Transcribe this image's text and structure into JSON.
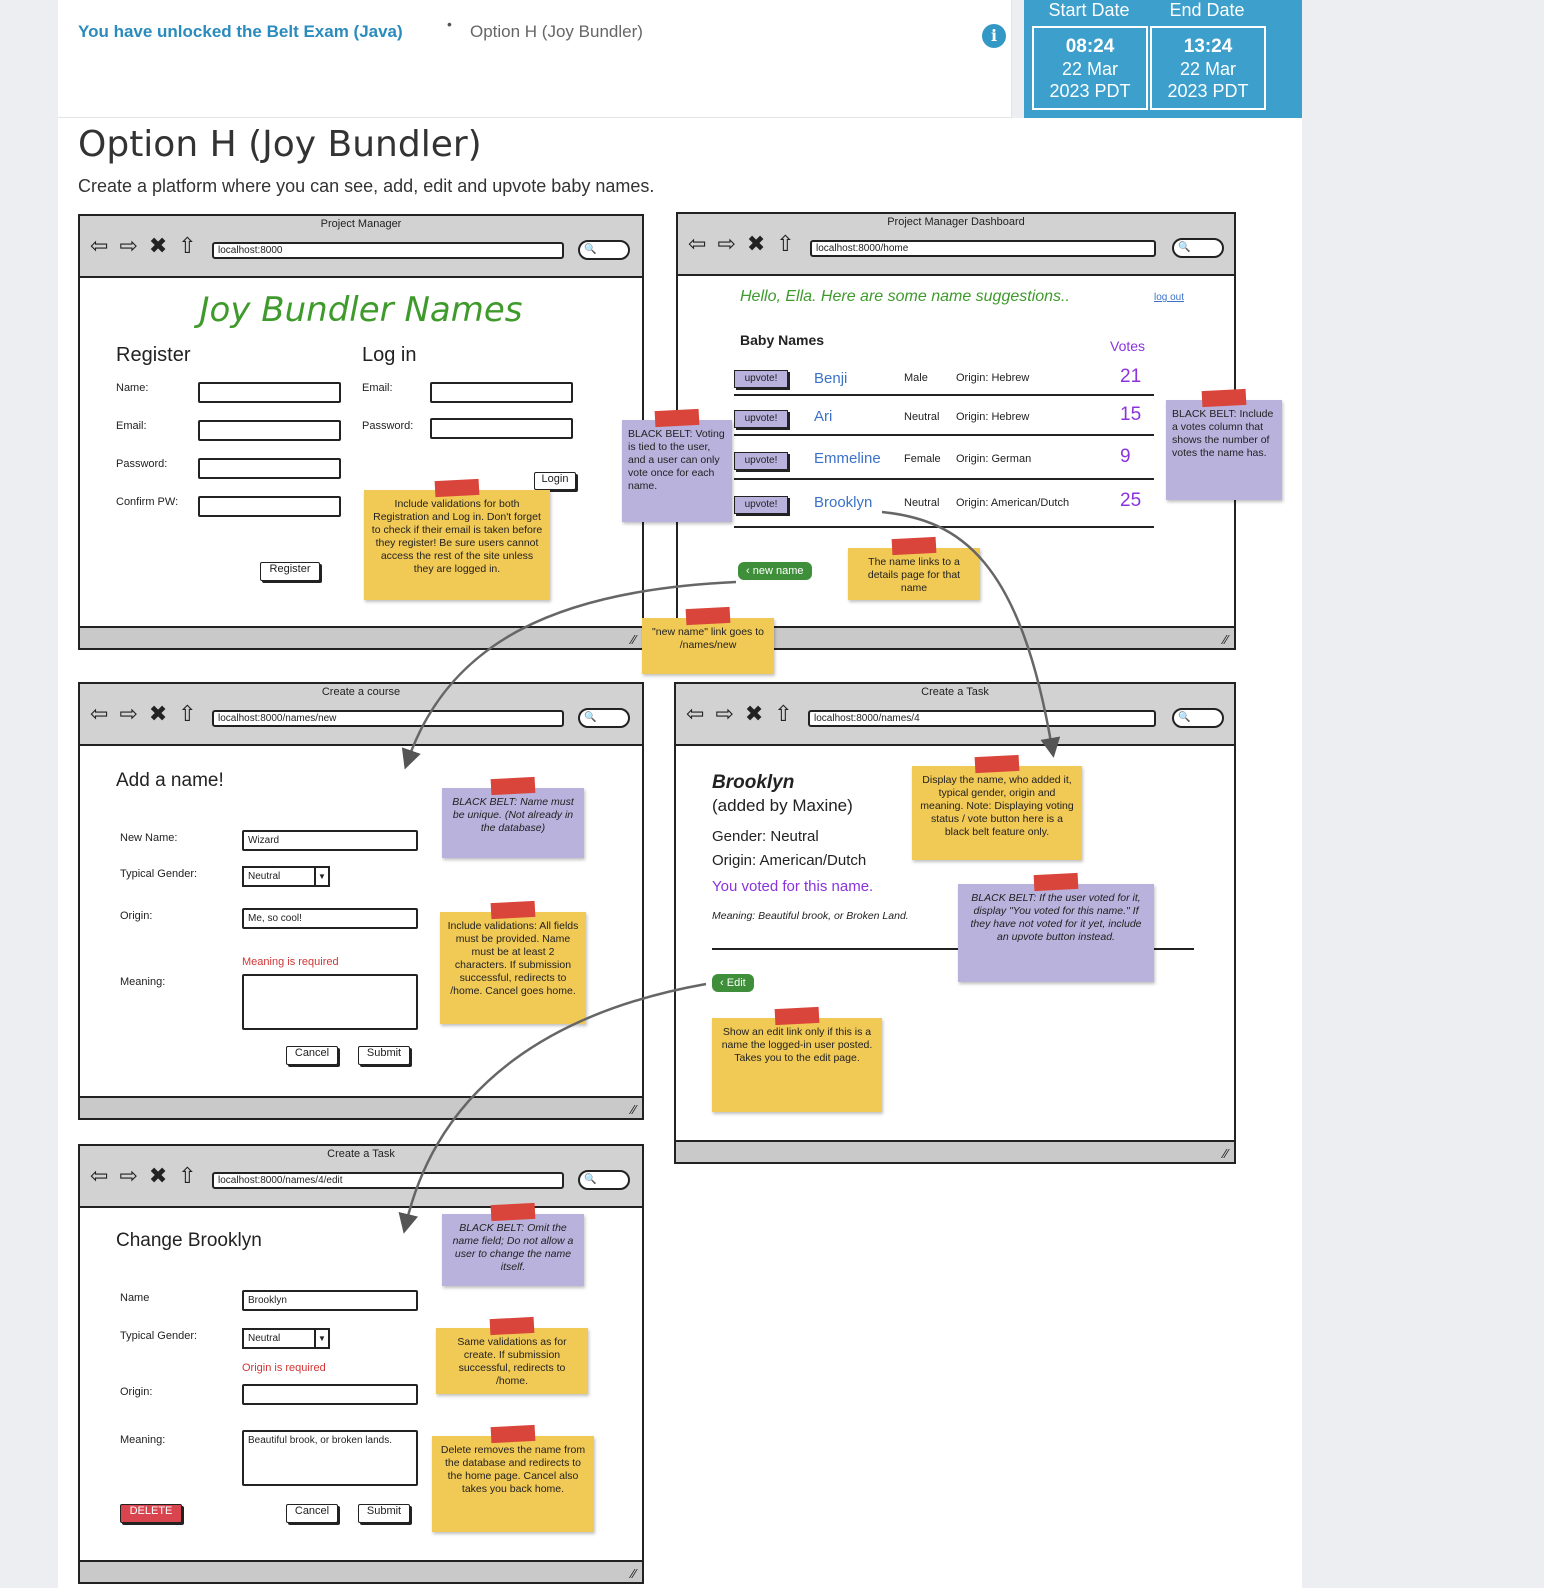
{
  "header": {
    "breadcrumb_link": "You have unlocked the Belt Exam (Java)",
    "breadcrumb_sep": "•",
    "breadcrumb_current": "Option H (Joy Bundler)",
    "info_icon": "i"
  },
  "dates": {
    "start_label": "Start Date",
    "end_label": "End Date",
    "start_time": "08:24",
    "start_day": "22 Mar",
    "start_tz": "2023 PDT",
    "end_time": "13:24",
    "end_day": "22 Mar",
    "end_tz": "2023 PDT"
  },
  "page": {
    "title": "Option H (Joy Bundler)",
    "description": "Create a platform where you can see, add, edit and upvote baby names."
  },
  "browser": {
    "nav_icons": "⇦ ⇨ ✖ ⇧",
    "search_icon": "🔍",
    "grip": "⁄⁄"
  },
  "win1": {
    "title": "Project Manager",
    "url": "localhost:8000",
    "app_title": "Joy Bundler Names",
    "register": "Register",
    "login": "Log in",
    "name_label": "Name:",
    "email_label": "Email:",
    "password_label": "Password:",
    "confirm_label": "Confirm PW:",
    "login_email_label": "Email:",
    "login_password_label": "Password:",
    "login_button": "Login",
    "register_button": "Register",
    "note": "Include validations for both Registration and Log in. Don't forget to check if their email is taken before they register! Be sure users cannot access the rest of the site unless they are logged in."
  },
  "win2": {
    "title": "Project Manager Dashboard",
    "url": "localhost:8000/home",
    "greeting": "Hello, Ella. Here are some name suggestions..",
    "logout": "log out",
    "list_title": "Baby Names",
    "votes_header": "Votes",
    "upvote_label": "upvote!",
    "names": [
      {
        "name": "Benji",
        "gender": "Male",
        "origin": "Origin: Hebrew",
        "votes": "21"
      },
      {
        "name": "Ari",
        "gender": "Neutral",
        "origin": "Origin: Hebrew",
        "votes": "15"
      },
      {
        "name": "Emmeline",
        "gender": "Female",
        "origin": "Origin: German",
        "votes": "9"
      },
      {
        "name": "Brooklyn",
        "gender": "Neutral",
        "origin": "Origin: American/Dutch",
        "votes": "25"
      }
    ],
    "new_name_button": "new name",
    "note_details": "The name links to a details page for that name",
    "note_new_name": "\"new name\" link goes to /names/new",
    "note_voting": "BLACK BELT: Voting is tied to the user, and a user can only vote once for each name.",
    "note_votes_col": "BLACK BELT: Include a votes column that shows the number of votes the name has."
  },
  "win3": {
    "title": "Create a course",
    "url": "localhost:8000/names/new",
    "heading": "Add a name!",
    "new_name_label": "New Name:",
    "new_name_value": "Wizard",
    "gender_label": "Typical Gender:",
    "gender_value": "Neutral",
    "origin_label": "Origin:",
    "origin_value": "Me, so cool!",
    "error": "Meaning is required",
    "meaning_label": "Meaning:",
    "cancel": "Cancel",
    "submit": "Submit",
    "note_unique": "BLACK BELT: Name must be unique. (Not already in the database)",
    "note_validations": "Include validations: All fields must be provided. Name must be at least 2 characters. If submission successful, redirects to /home. Cancel goes home."
  },
  "win4": {
    "title": "Create a Task",
    "url": "localhost:8000/names/4",
    "name": "Brooklyn",
    "added_by": "(added by Maxine)",
    "gender": "Gender: Neutral",
    "origin": "Origin: American/Dutch",
    "voted": "You voted for this name.",
    "meaning": "Meaning: Beautiful brook, or Broken Land.",
    "edit_button": "Edit",
    "note_display": "Display the name, who added it, typical gender, origin and meaning. Note: Displaying voting status / vote button here is a black belt feature only.",
    "note_voted": "BLACK BELT: If the user voted for it, display \"You voted for this name.\" If they have not voted for it yet, include an upvote button instead.",
    "note_edit": "Show an edit link only if this is a name the logged-in user posted. Takes you to the edit page."
  },
  "win5": {
    "title": "Create a Task",
    "url": "localhost:8000/names/4/edit",
    "heading": "Change Brooklyn",
    "name_label": "Name",
    "name_value": "Brooklyn",
    "gender_label": "Typical Gender:",
    "gender_value": "Neutral",
    "error": "Origin is required",
    "origin_label": "Origin:",
    "meaning_label": "Meaning:",
    "meaning_value": "Beautiful brook, or broken lands.",
    "delete": "DELETE",
    "cancel": "Cancel",
    "submit": "Submit",
    "note_omit": "BLACK BELT: Omit the name field; Do not allow a user to change the name itself.",
    "note_same": "Same validations as for create. If submission successful, redirects to /home.",
    "note_delete": "Delete removes the name from the database and redirects to the home page. Cancel also takes you back home."
  }
}
